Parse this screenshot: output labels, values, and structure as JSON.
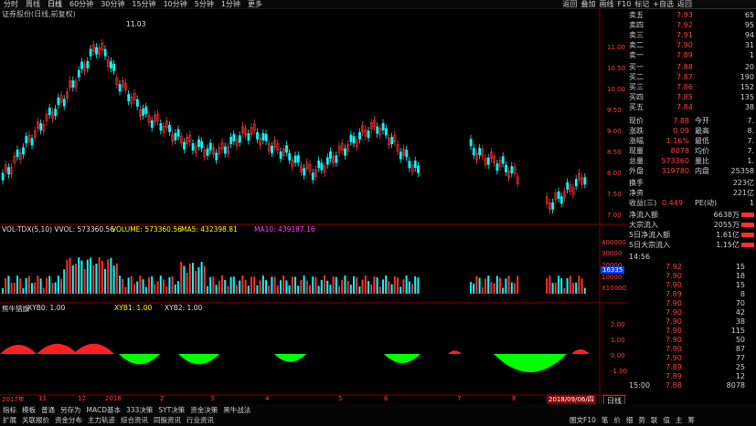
{
  "topbar": {
    "items": [
      "分时",
      "周线",
      "日线",
      "60分钟",
      "30分钟",
      "15分钟",
      "10分钟",
      "5分钟",
      "1分钟",
      "更多"
    ],
    "selected_index": 2,
    "right_items": [
      "返回",
      "叠加",
      "画线",
      "F10",
      "标记",
      "+自选",
      "返回"
    ]
  },
  "stock": {
    "title": "证券股份(日线,前复权)"
  },
  "main_chart": {
    "high_label": "11.03",
    "axis": [
      "11.00",
      "10.50",
      "10.00",
      "9.50",
      "9.00",
      "8.50",
      "8.00",
      "7.50",
      "7.00"
    ]
  },
  "volume_chart": {
    "line_label": "VOL-TDX(5,10)  VVOL: 573360.56",
    "volume": "VOLUME: 573360.56",
    "ma5": "MA5: 432398.81",
    "ma10": "MA10: 439187.16",
    "axis": [
      "400000",
      "30000",
      "20000",
      "10000",
      "X10000"
    ],
    "current_tag": "16335"
  },
  "indicator": {
    "name": "熊牛猎旗",
    "xyb0": "XYB0: 1.00",
    "xyb1": "XYB1: 1.00",
    "xyb2": "XYB2: 1.00",
    "axis": [
      "2.00",
      "1.00",
      "0.00",
      "-1.00"
    ]
  },
  "date_axis": {
    "labels": [
      "2017年",
      "11",
      "12",
      "2018",
      "2",
      "3",
      "4",
      "5",
      "6",
      "7",
      "8"
    ],
    "current": "2018/09/06/四"
  },
  "order_book": {
    "asks": [
      {
        "label": "卖五",
        "price": "7.93",
        "vol": "65"
      },
      {
        "label": "卖四",
        "price": "7.92",
        "vol": "95"
      },
      {
        "label": "卖三",
        "price": "7.91",
        "vol": "94"
      },
      {
        "label": "卖二",
        "price": "7.90",
        "vol": "31"
      },
      {
        "label": "卖一",
        "price": "7.89",
        "vol": "1"
      }
    ],
    "bids": [
      {
        "label": "买一",
        "price": "7.88",
        "vol": "20"
      },
      {
        "label": "买二",
        "price": "7.87",
        "vol": "190"
      },
      {
        "label": "买三",
        "price": "7.86",
        "vol": "152"
      },
      {
        "label": "买四",
        "price": "7.85",
        "vol": "135"
      },
      {
        "label": "买五",
        "price": "7.84",
        "vol": "38"
      }
    ]
  },
  "quote": {
    "rows": [
      {
        "a": "现价",
        "av": "7.88",
        "b": "今开",
        "bv": "7."
      },
      {
        "a": "涨跌",
        "av": "0.09",
        "b": "最高",
        "bv": "8."
      },
      {
        "a": "涨幅",
        "av": "1.16%",
        "b": "最低",
        "bv": "7."
      },
      {
        "a": "现量",
        "av": "8078",
        "b": "均价",
        "bv": "7."
      },
      {
        "a": "总量",
        "av": "573360",
        "b": "量比",
        "bv": "1."
      },
      {
        "a": "外盘",
        "av": "319780",
        "b": "内盘",
        "bv": "25358"
      }
    ],
    "extra": [
      {
        "a": "换手",
        "v": "223亿"
      },
      {
        "a": "净资",
        "v": "221亿"
      },
      {
        "a": "收益(三)",
        "v": "0.449",
        "b": "PE(动)",
        "bv": "1"
      }
    ]
  },
  "flows": [
    {
      "label": "净流入额",
      "value": "6638万"
    },
    {
      "label": "大宗流入",
      "value": "2055万"
    },
    {
      "label": "5日净流入额",
      "value": "1.61亿"
    },
    {
      "label": "5日大宗流入",
      "value": "1.15亿"
    }
  ],
  "ticks": {
    "time": "14:56",
    "rows": [
      {
        "p": "7.92",
        "v": "15"
      },
      {
        "p": "7.90",
        "v": "18"
      },
      {
        "p": "7.90",
        "v": "15"
      },
      {
        "p": "7.89",
        "v": "8"
      },
      {
        "p": "7.90",
        "v": "70"
      },
      {
        "p": "7.90",
        "v": "42"
      },
      {
        "p": "7.90",
        "v": "38"
      },
      {
        "p": "7.90",
        "v": "115"
      },
      {
        "p": "7.90",
        "v": "50"
      },
      {
        "p": "7.90",
        "v": "87"
      },
      {
        "p": "7.90",
        "v": "77"
      },
      {
        "p": "7.89",
        "v": "25"
      },
      {
        "p": "7.89",
        "v": "12"
      }
    ],
    "end_time": "15:00",
    "end_price": "7.88",
    "end_vol": "8078"
  },
  "bottom": {
    "row1": [
      "指标",
      "模板",
      "普通",
      "另存为",
      "MACD基本",
      "333决策",
      "SYT决策",
      "资金决策",
      "黑牛战法"
    ],
    "row2": [
      "扩展",
      "关联报价",
      "资金分布",
      "主力轨迹",
      "综合资讯",
      "同股资讯",
      "行业资讯"
    ],
    "right": [
      "图文F10",
      "笔",
      "价",
      "细",
      "势",
      "联",
      "值",
      "主",
      "筹"
    ]
  },
  "right_tabs": {
    "daily": "日线"
  }
}
